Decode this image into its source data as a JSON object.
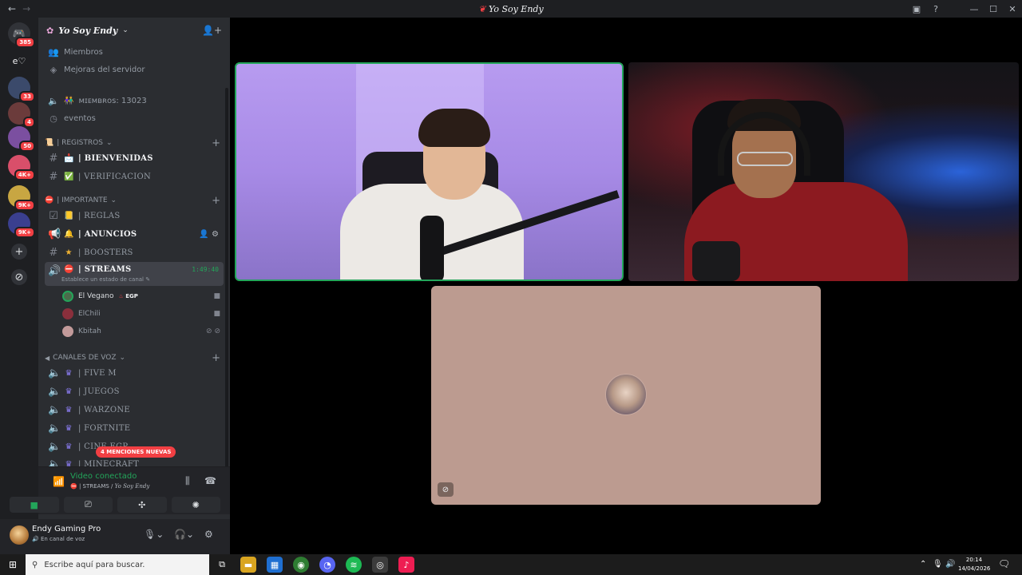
{
  "window": {
    "title": "Yo Soy Endy",
    "nav_back": "←",
    "nav_forward": "→"
  },
  "rail": {
    "servers": [
      {
        "name": "Discord",
        "badge": "385",
        "color": "#313338"
      },
      {
        "name": "e♡",
        "badge": "",
        "color": "#313338"
      },
      {
        "name": "server-3",
        "badge": "33",
        "color": "#3b4a6b"
      },
      {
        "name": "server-4",
        "badge": "4",
        "color": "#6b3b3b"
      },
      {
        "name": "server-5",
        "badge": "50",
        "color": "#7b4fa0"
      },
      {
        "name": "server-6",
        "badge": "4K+",
        "color": "#d94f6a"
      },
      {
        "name": "server-7",
        "badge": "9K+",
        "color": "#c8a642"
      },
      {
        "name": "server-8",
        "badge": "9K+",
        "color": "#3a3f8f"
      }
    ],
    "e_heart": "e♡",
    "add": "+",
    "discover": "⊘"
  },
  "sidebar": {
    "server_name": "Yo Soy Endy",
    "members_label": "Miembros",
    "boost_label": "Mejoras del servidor",
    "member_count": "ᴍɪᴇᴍʙʀᴏs: 13023",
    "events_label": "eventos",
    "categories": {
      "registros": "| REGISTROS",
      "importante": "| IMPORTANTE",
      "voz": "CANALES DE VOZ"
    },
    "channels": {
      "bienvenidas": "| BIENVENIDAS",
      "verificacion": "| VERIFICACION",
      "reglas": "| REGLAS",
      "anuncios": "| ANUNCIOS",
      "boosters": "| BOOSTERS",
      "streams": "| STREAMS",
      "streams_time": "1:49:40",
      "streams_status": "Establece un estado de canal ✎",
      "five_m": "| FIVE M",
      "juegos": "| JUEGOS",
      "warzone": "| WARZONE",
      "fortnite": "| FORTNITE",
      "cine": "| CINE EGP",
      "minecraft": "| MINECRAFT"
    },
    "voice_users": [
      {
        "name": "El Vegano",
        "tag": "EGP"
      },
      {
        "name": "ElChili",
        "tag": ""
      },
      {
        "name": "Kbitah",
        "tag": ""
      }
    ],
    "mentions_pill": "4 MENCIONES NUEVAS"
  },
  "voice_panel": {
    "title": "Video conectado",
    "channel": "| STREAMS /",
    "server": "Yo Soy Endy"
  },
  "user": {
    "name": "Endy Gaming Pro",
    "status": "En canal de voz"
  },
  "taskbar": {
    "search_placeholder": "Escribe aquí para buscar.",
    "time": "20:14",
    "date": "14/04/2026",
    "notify_count": "2"
  },
  "colors": {
    "speaking_border": "#23a55a",
    "mention_red": "#f23f43",
    "tile3_bg": "#bc9b90"
  }
}
